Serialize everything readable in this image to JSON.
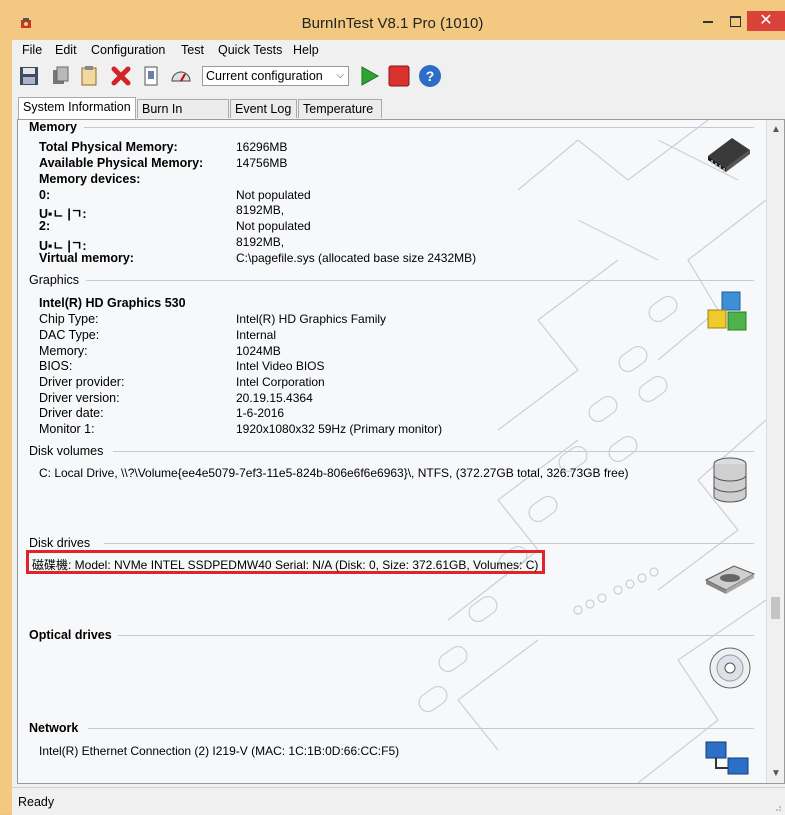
{
  "window": {
    "title": "BurnInTest V8.1 Pro (1010)",
    "close_glyph": "✕"
  },
  "menu": [
    "File",
    "Edit",
    "Configuration",
    "Test",
    "Quick Tests",
    "Help"
  ],
  "toolbar": {
    "icons": [
      "save-icon",
      "copy-icon",
      "clipboard-icon",
      "delete-icon",
      "report-icon",
      "gauge-icon",
      "play-icon",
      "stop-icon",
      "help-icon"
    ],
    "config_value": "Current configuration",
    "dropdown_arrow": "⌵",
    "help_glyph": "?"
  },
  "tabs": [
    "System Information",
    "Burn In Results",
    "Event Log",
    "Temperature"
  ],
  "sections": {
    "memory": {
      "title": "Memory",
      "rows": [
        {
          "label": "Total Physical Memory:",
          "value": "16296MB"
        },
        {
          "label": "Available Physical Memory:",
          "value": "14756MB"
        },
        {
          "label": "Memory devices:",
          "value": ""
        },
        {
          "label": "0:",
          "value": "Not populated"
        },
        {
          "label": "U▪ㄴ |ㄱ:",
          "value": "8192MB,"
        },
        {
          "label": "2:",
          "value": "Not populated"
        },
        {
          "label": "U▪ㄴ |ㄱ:",
          "value": "8192MB,"
        },
        {
          "label": "Virtual memory:",
          "value": "C:\\pagefile.sys (allocated base size 2432MB)"
        }
      ]
    },
    "graphics": {
      "title": "Graphics",
      "adapter": "Intel(R) HD Graphics 530",
      "rows": [
        {
          "label": "Chip Type:",
          "value": "Intel(R) HD Graphics Family"
        },
        {
          "label": "DAC Type:",
          "value": "Internal"
        },
        {
          "label": "Memory:",
          "value": "1024MB"
        },
        {
          "label": "BIOS:",
          "value": "Intel Video BIOS"
        },
        {
          "label": "Driver provider:",
          "value": "Intel Corporation"
        },
        {
          "label": "Driver version:",
          "value": "20.19.15.4364"
        },
        {
          "label": "Driver date:",
          "value": "1-6-2016"
        },
        {
          "label": "Monitor 1:",
          "value": "1920x1080x32 59Hz (Primary monitor)"
        }
      ]
    },
    "disk_volumes": {
      "title": "Disk volumes",
      "line": "C:  Local Drive, \\\\?\\Volume{ee4e5079-7ef3-11e5-824b-806e6f6e6963}\\, NTFS, (372.27GB total, 326.73GB free)"
    },
    "disk_drives": {
      "title": "Disk drives",
      "line": "磁碟機: Model: NVMe INTEL SSDPEDMW40 Serial: N/A (Disk: 0, Size: 372.61GB, Volumes: C)"
    },
    "optical_drives": {
      "title": "Optical drives"
    },
    "network": {
      "title": "Network",
      "line": "Intel(R) Ethernet Connection (2) I219-V (MAC: 1C:1B:0D:66:CC:F5)"
    }
  },
  "scroll": {
    "up": "▲",
    "down": "▼"
  },
  "status": {
    "text": "Ready"
  },
  "colors": {
    "highlight_border": "#e1242a",
    "title_bar": "#f3c982",
    "close_button": "#d9413b"
  }
}
